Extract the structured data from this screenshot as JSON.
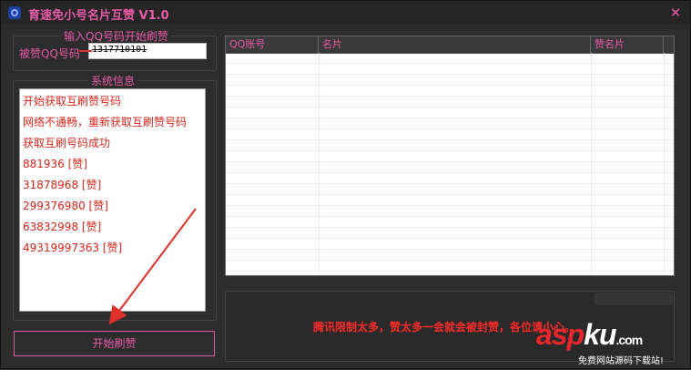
{
  "window": {
    "title": "育速免小号名片互赞 V1.0",
    "close_icon": "close-icon"
  },
  "input_group": {
    "title": "输入QQ号码开始刷赞",
    "label": "被赞QQ号码",
    "value": "1317710101"
  },
  "log_group": {
    "title": "系统信息",
    "lines": [
      "开始获取互刷赞号码",
      "网络不通畅，重新获取互刷赞号码",
      "获取互刷号码成功",
      "881936 [赞]",
      "31878968 [赞]",
      "299376980 [赞]",
      "63832998 [赞]",
      "49319997363 [赞]"
    ]
  },
  "start_button": {
    "label": "开始刷赞"
  },
  "table": {
    "columns": [
      "QQ账号",
      "名片",
      "赞名片"
    ]
  },
  "notice": "腾讯限制太多，赞太多一会就会被封赞，各位请小心。",
  "watermark": {
    "brand_left": "asp",
    "brand_right": "ku",
    "brand_suffix": ".com",
    "tagline": "免费网站源码下载站!"
  },
  "colors": {
    "accent": "#e85aa8",
    "log_text": "#d8261a",
    "notice": "#ff2a2a",
    "arrow": "#e0302a"
  }
}
